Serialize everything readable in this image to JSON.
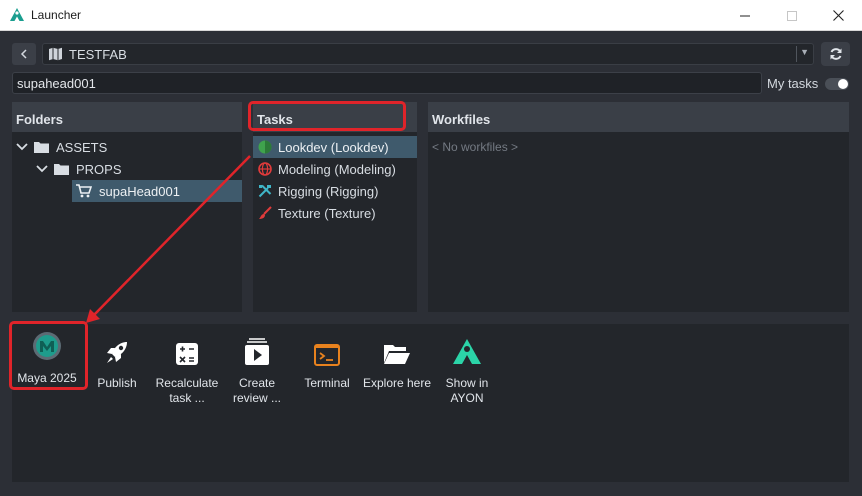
{
  "window": {
    "title": "Launcher"
  },
  "project": {
    "name": "TESTFAB"
  },
  "search": {
    "value": "supahead001"
  },
  "my_tasks": {
    "label": "My tasks",
    "enabled": false
  },
  "folders": {
    "header": "Folders",
    "items": [
      {
        "label": "ASSETS",
        "expanded": true
      },
      {
        "label": "PROPS",
        "expanded": true
      },
      {
        "label": "supaHead001",
        "selected": true
      }
    ]
  },
  "tasks": {
    "header": "Tasks",
    "items": [
      {
        "label": "Lookdev (Lookdev)",
        "icon": "lookdev-icon",
        "color": "#3fa34d",
        "selected": true
      },
      {
        "label": "Modeling (Modeling)",
        "icon": "globe-icon",
        "color": "#e03b3b"
      },
      {
        "label": "Rigging (Rigging)",
        "icon": "tools-icon",
        "color": "#3fb6c8"
      },
      {
        "label": "Texture (Texture)",
        "icon": "brush-icon",
        "color": "#e03b3b"
      }
    ]
  },
  "workfiles": {
    "header": "Workfiles",
    "empty": "< No workfiles >"
  },
  "actions": [
    {
      "label": "Maya 2025",
      "icon": "maya-icon"
    },
    {
      "label": "Publish",
      "icon": "rocket-icon"
    },
    {
      "label": "Recalculate task ...",
      "icon": "calculator-icon"
    },
    {
      "label": "Create review ...",
      "icon": "review-icon"
    },
    {
      "label": "Terminal",
      "icon": "terminal-icon"
    },
    {
      "label": "Explore here",
      "icon": "folder-open-icon"
    },
    {
      "label": "Show in AYON",
      "icon": "ayon-icon"
    }
  ],
  "colors": {
    "selection": "#3f5a6c",
    "panel": "#23262b",
    "header": "#3a3f47",
    "highlight": "#e0242a",
    "terminal": "#e8821e"
  }
}
